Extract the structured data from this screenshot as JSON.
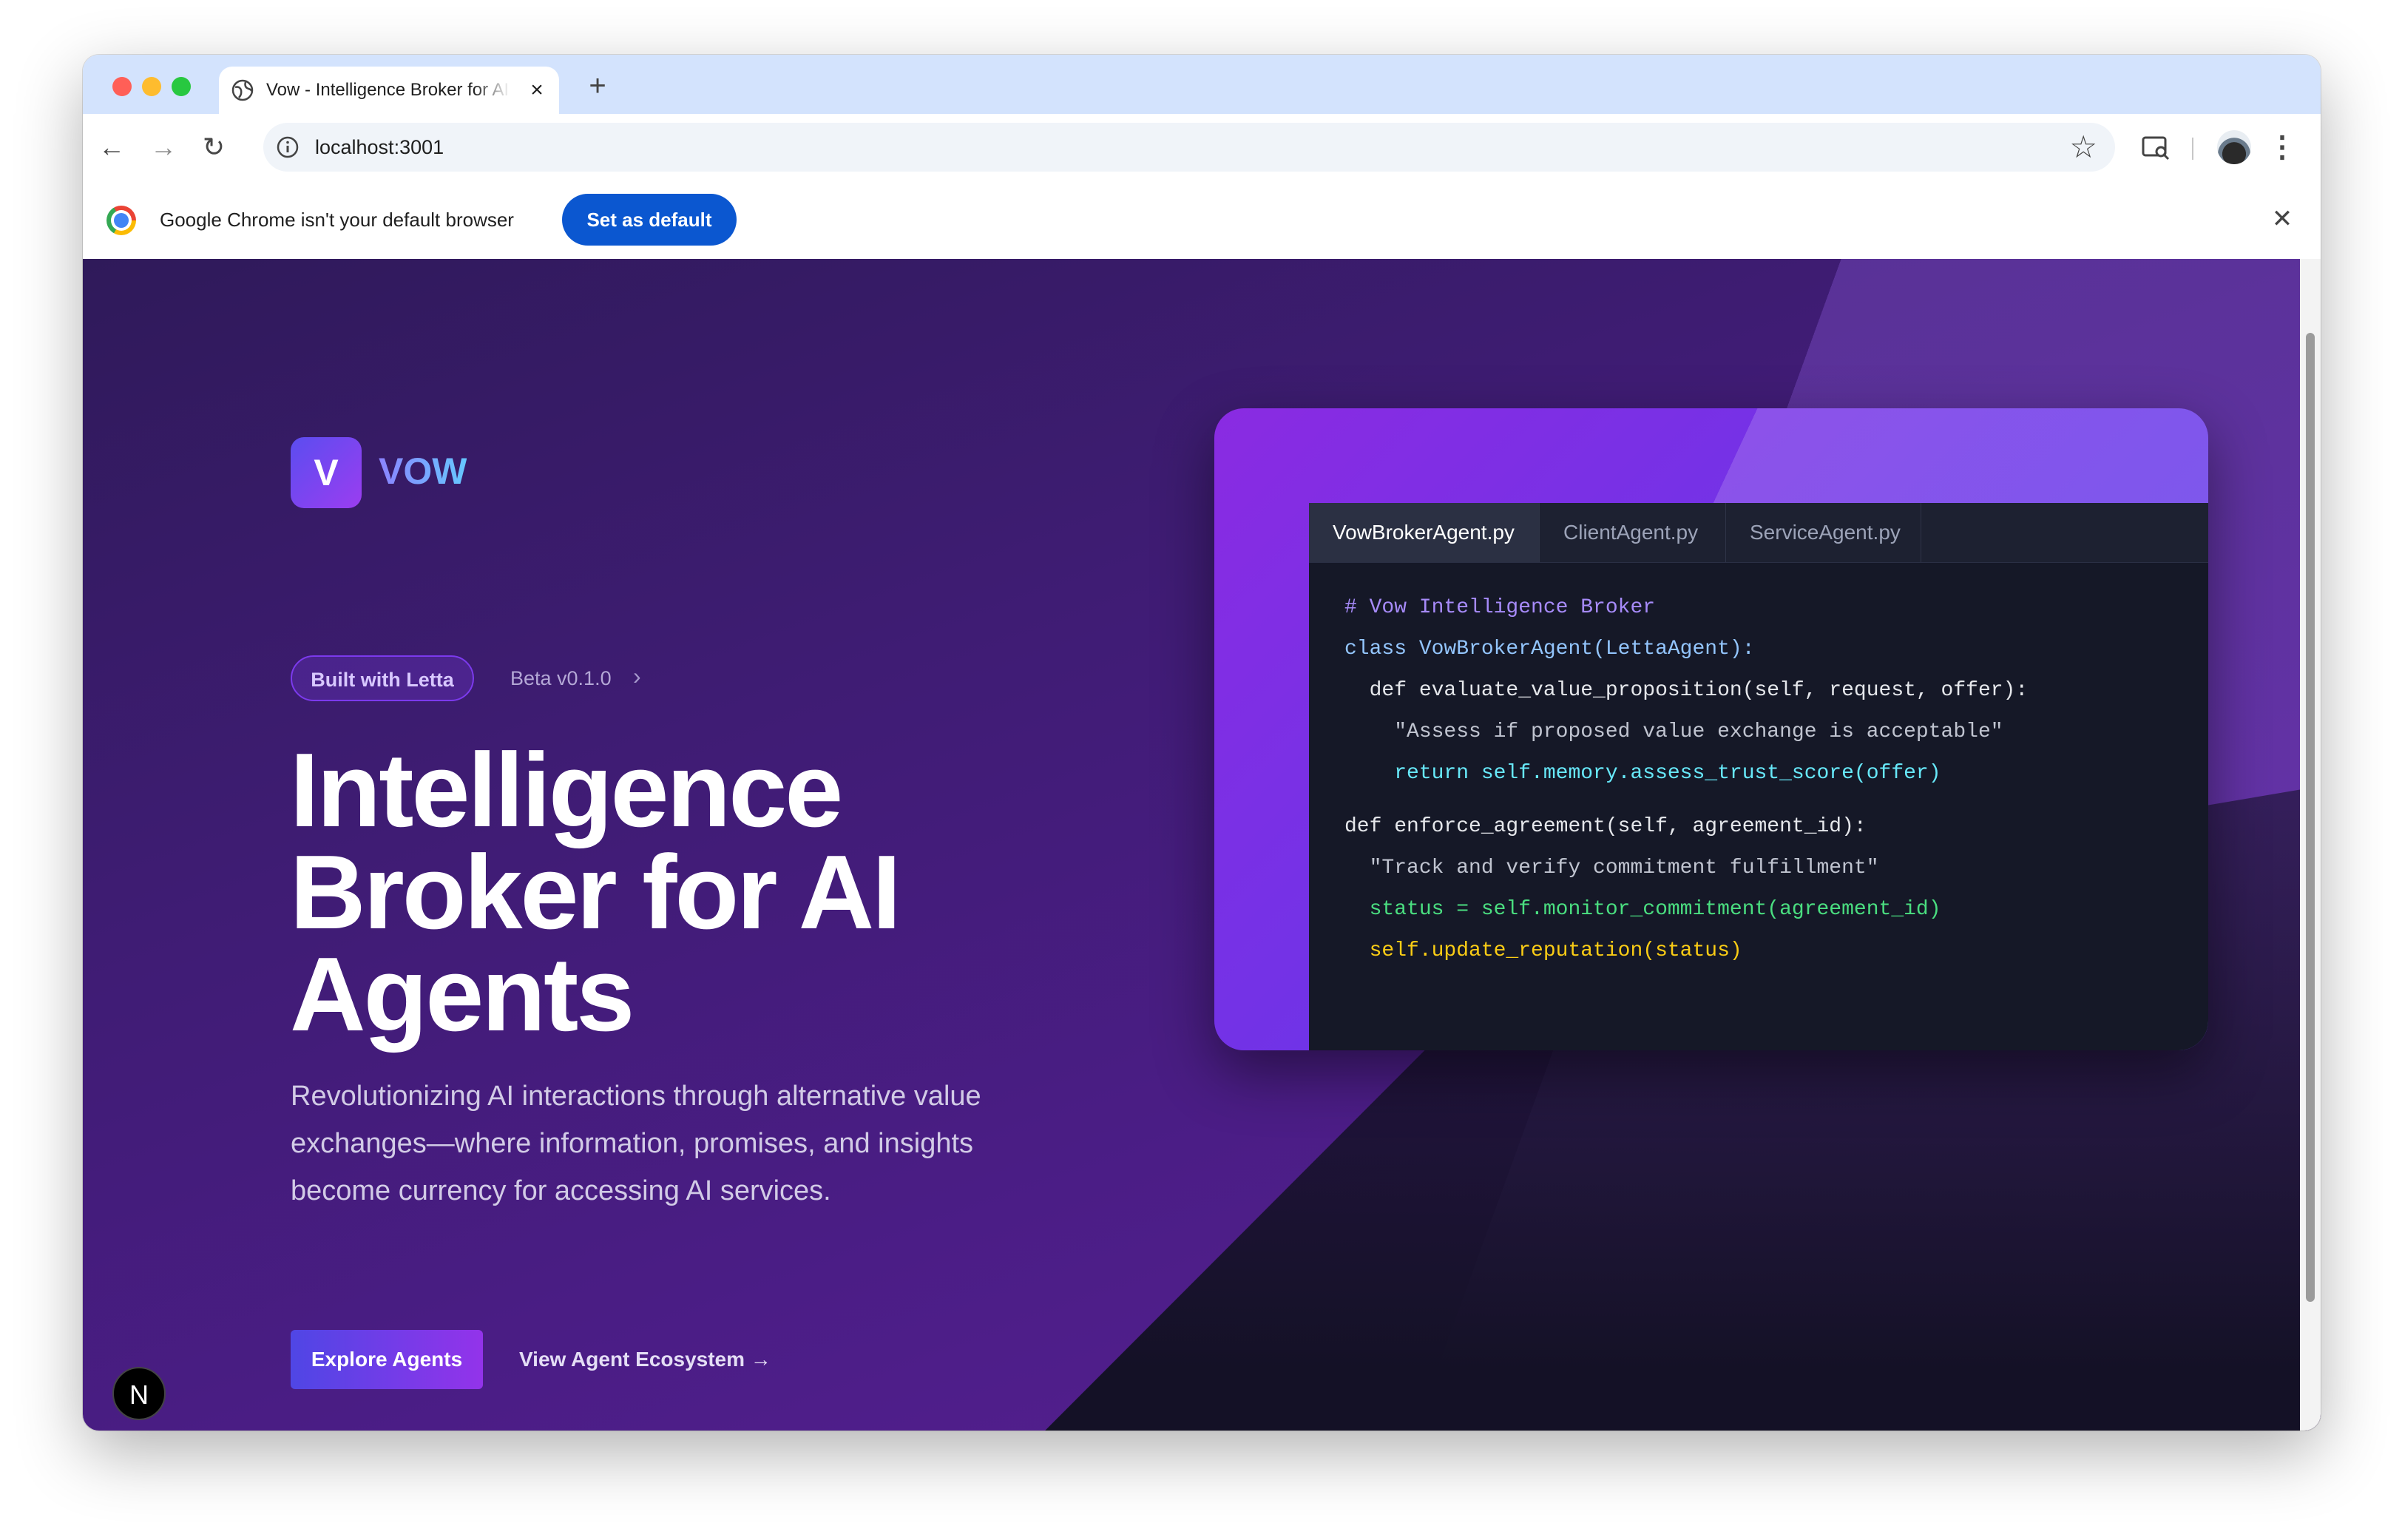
{
  "browser": {
    "tab_title": "Vow - Intelligence Broker for AI Agents",
    "url": "localhost:3001",
    "infobar_text": "Google Chrome isn't your default browser",
    "set_default_label": "Set as default"
  },
  "hero": {
    "logo_letter": "V",
    "logo_text": "VOW",
    "badge": "Built with Letta",
    "version": "Beta v0.1.0",
    "title": "Intelligence Broker for AI Agents",
    "subtitle": "Revolutionizing AI interactions through alternative value exchanges—where information, promises, and insights become currency for accessing AI services.",
    "primary_cta": "Explore Agents",
    "secondary_cta": "View Agent Ecosystem →",
    "dev_badge": "N"
  },
  "code_panel": {
    "tabs": [
      "VowBrokerAgent.py",
      "ClientAgent.py",
      "ServiceAgent.py"
    ],
    "active_tab": "VowBrokerAgent.py",
    "lines": [
      "# Vow Intelligence Broker",
      "class VowBrokerAgent(LettaAgent):",
      "  def evaluate_value_proposition(self, request, offer):",
      "    \"Assess if proposed value exchange is acceptable\"",
      "    return self.memory.assess_trust_score(offer)",
      "def enforce_agreement(self, agreement_id):",
      "  \"Track and verify commitment fulfillment\"",
      "  status = self.monitor_commitment(agreement_id)",
      "  self.update_reputation(status)"
    ]
  },
  "colors": {
    "page_bg": "#3f1c74",
    "accent": "#7c3aed",
    "chrome_blue": "#0b57d0"
  }
}
